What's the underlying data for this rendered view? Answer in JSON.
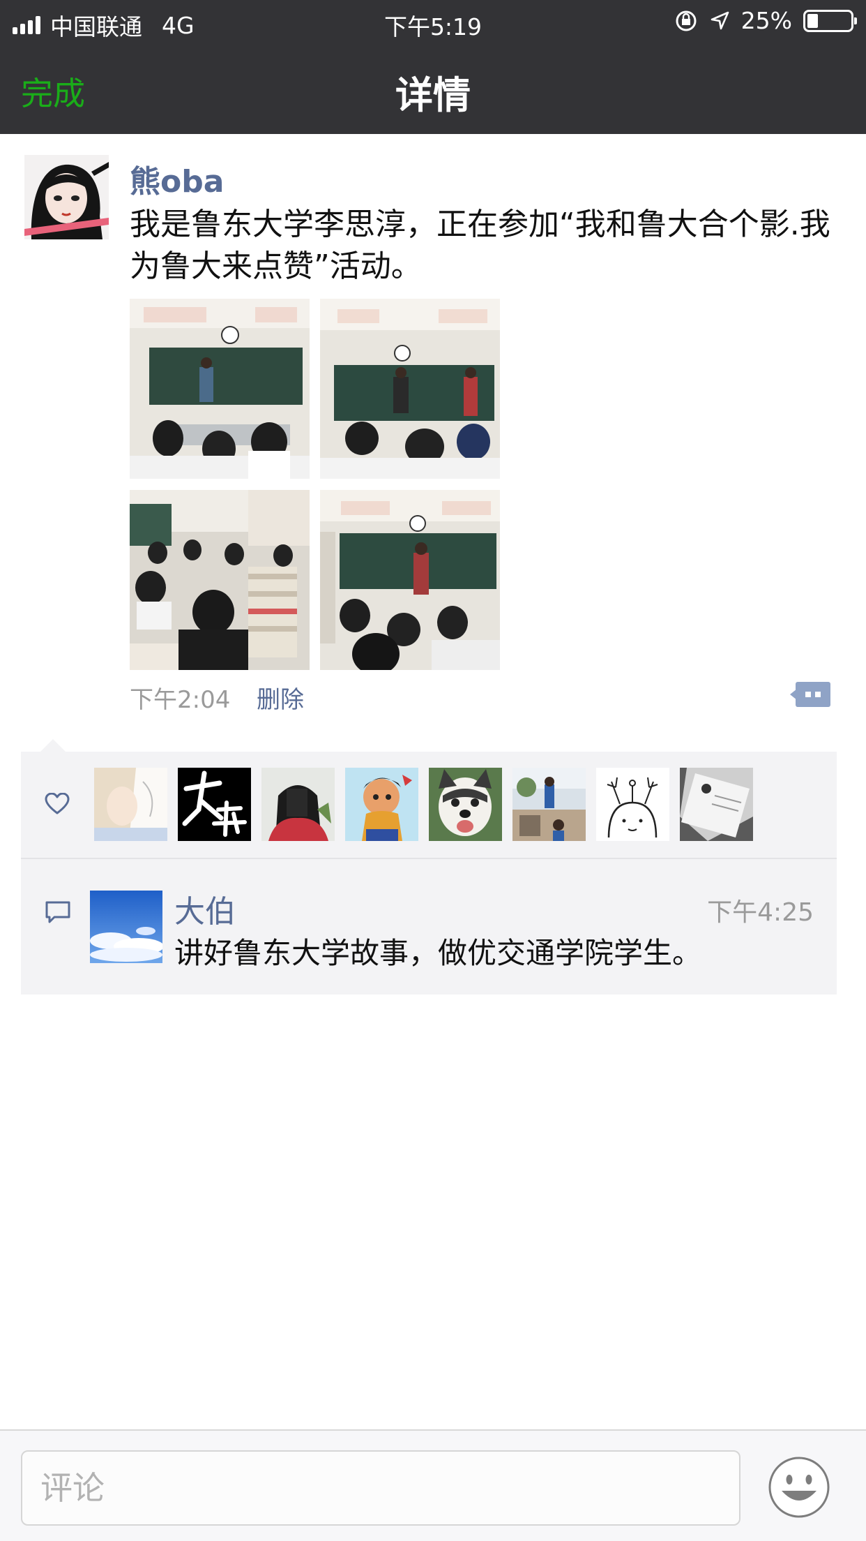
{
  "status_bar": {
    "carrier": "中国联通",
    "network": "4G",
    "time": "下午5:19",
    "battery_percent": "25%",
    "battery_level": 0.25
  },
  "nav": {
    "done_label": "完成",
    "title": "详情"
  },
  "post": {
    "author": "熊oba",
    "text": "我是鲁东大学李思淳，正在参加“我和鲁大合个影.我为鲁大来点赞”活动。",
    "time": "下午2:04",
    "delete_label": "删除",
    "photos": [
      {
        "icon": "classroom-photo"
      },
      {
        "icon": "classroom-photo"
      },
      {
        "icon": "classroom-photo"
      },
      {
        "icon": "classroom-photo"
      }
    ]
  },
  "likes": {
    "icon": "heart-outline-icon",
    "avatars": [
      {
        "icon": "anime-avatar"
      },
      {
        "icon": "calligraphy-avatar"
      },
      {
        "icon": "girl-selfie-avatar"
      },
      {
        "icon": "cartoon-avatar"
      },
      {
        "icon": "dog-avatar"
      },
      {
        "icon": "outdoor-avatar"
      },
      {
        "icon": "sketch-avatar"
      },
      {
        "icon": "card-avatar"
      }
    ]
  },
  "comments": [
    {
      "author": "大伯",
      "time": "下午4:25",
      "text": "讲好鲁东大学故事，做优交通学院学生。"
    }
  ],
  "input": {
    "placeholder": "评论",
    "value": ""
  },
  "colors": {
    "bar_bg": "#333336",
    "accent_green": "#1aad19",
    "link_blue": "#576b95",
    "panel_bg": "#f3f3f5"
  }
}
